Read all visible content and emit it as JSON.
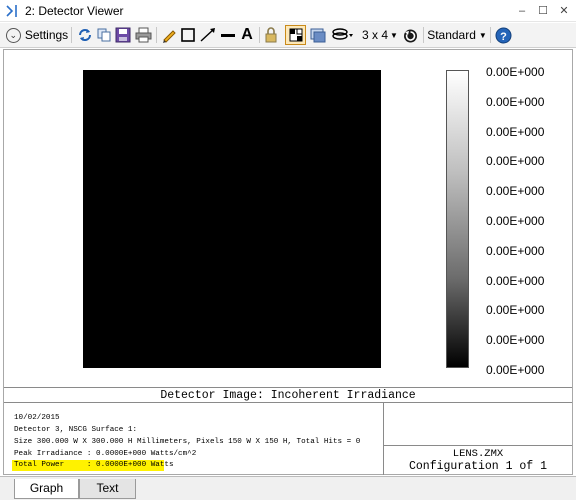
{
  "window": {
    "title": "2: Detector Viewer",
    "controls": {
      "minimize": "–",
      "maximize": "☐",
      "close": "✕"
    }
  },
  "toolbar": {
    "settings_label": "Settings",
    "layout_label": "3 x 4",
    "standard_label": "Standard",
    "icons": [
      "refresh-icon",
      "copy-icon",
      "save-icon",
      "print-icon",
      "pencil-icon",
      "rectangle-icon",
      "arrow-line-icon",
      "line-icon",
      "text-icon",
      "lock-icon",
      "grid-select-icon",
      "window-icon",
      "layers-icon",
      "rotate-icon",
      "help-icon"
    ]
  },
  "graph": {
    "colorbar_labels": [
      "0.00E+000",
      "0.00E+000",
      "0.00E+000",
      "0.00E+000",
      "0.00E+000",
      "0.00E+000",
      "0.00E+000",
      "0.00E+000",
      "0.00E+000",
      "0.00E+000",
      "0.00E+000"
    ],
    "caption": "Detector Image: Incoherent Irradiance",
    "info": {
      "date": "10/02/2015",
      "detector": "Detector 3, NSCG Surface 1:",
      "size": "Size 300.000 W X 300.000 H Millimeters, Pixels 150 W X 150 H, Total Hits = 0",
      "peak": "Peak Irradiance : 0.0000E+000 Watts/cm^2",
      "total_power": "Total Power     : 0.0000E+000 Watts"
    },
    "filename": "LENS.ZMX",
    "configuration": "Configuration 1 of 1"
  },
  "tabs": [
    {
      "label": "Graph"
    },
    {
      "label": "Text"
    }
  ],
  "colors": {
    "highlight": "#fff200",
    "image_background": "#000000",
    "accent_blue": "#1e5fb4"
  }
}
